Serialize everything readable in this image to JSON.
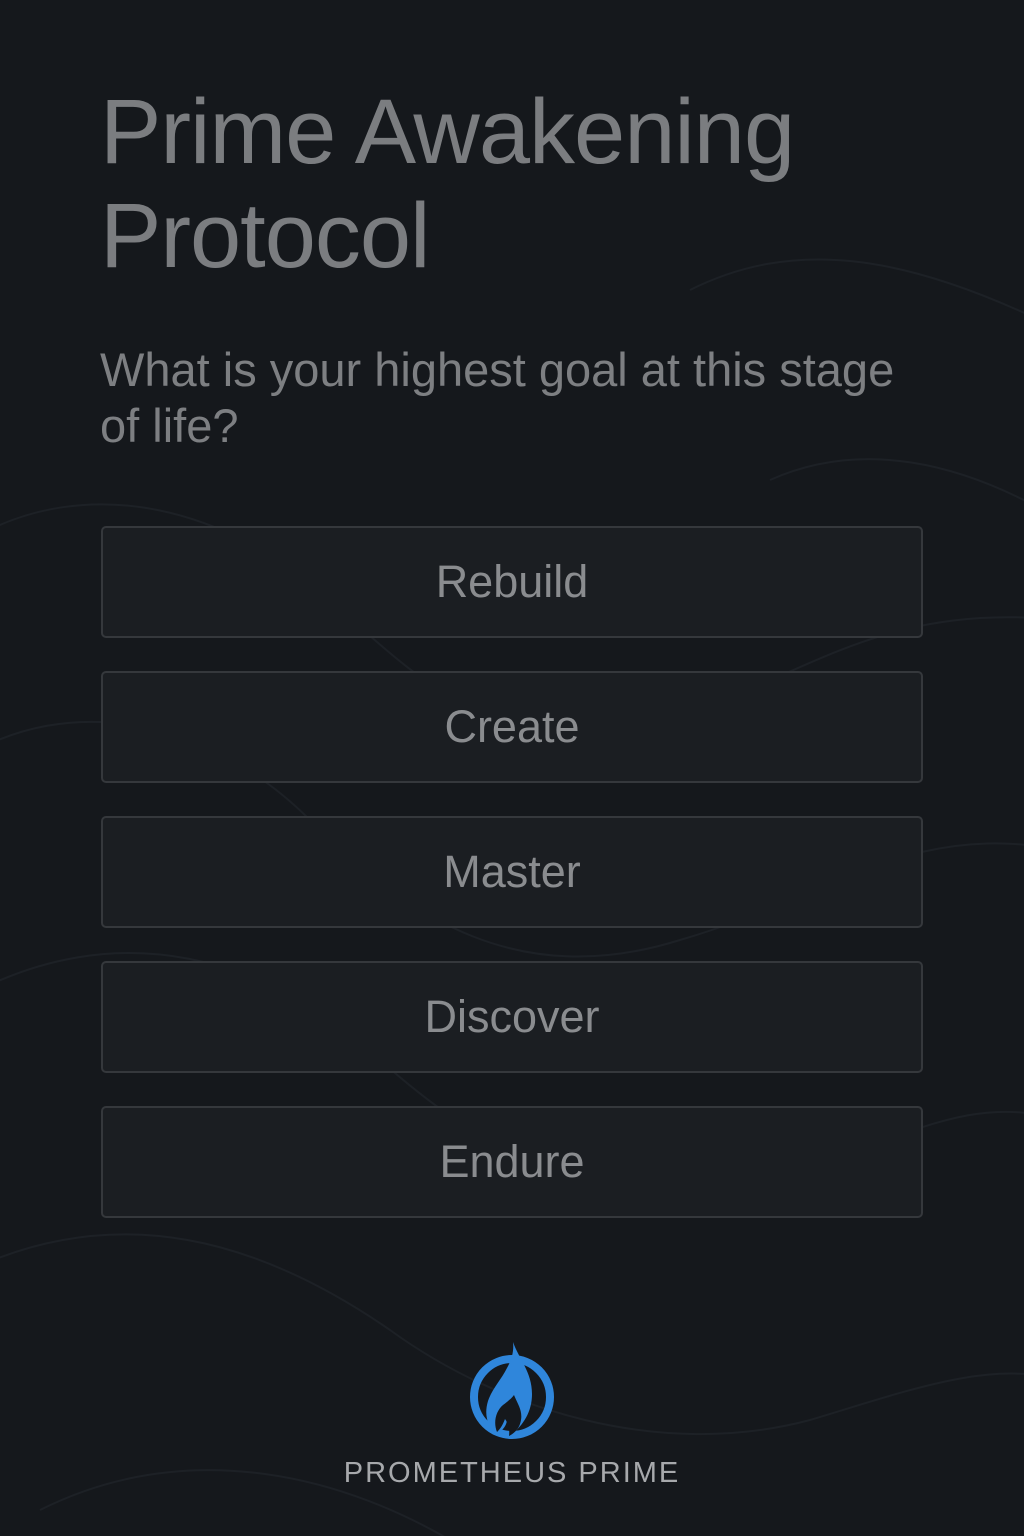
{
  "header": {
    "title_line1": "Prime Awakening",
    "title_line2": "Protocol"
  },
  "prompt": {
    "question": "What is your highest goal at this stage of life?"
  },
  "options": [
    {
      "label": "Rebuild"
    },
    {
      "label": "Create"
    },
    {
      "label": "Master"
    },
    {
      "label": "Discover"
    },
    {
      "label": "Endure"
    }
  ],
  "brand": {
    "name": "PROMETHEUS PRIME",
    "logo_icon": "flame-ring-icon",
    "accent_color": "#2f86db"
  },
  "theme": {
    "background": "#15181c",
    "option_background": "#1b1e22",
    "option_border": "#35383c",
    "title_color": "#7b7d80",
    "text_color": "#8a8c8f"
  }
}
